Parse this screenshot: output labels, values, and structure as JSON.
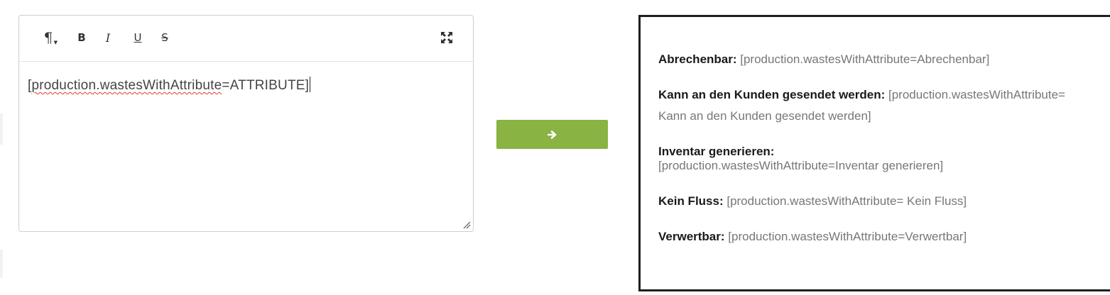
{
  "editor": {
    "toolbar": {
      "paragraph_icon": "¶",
      "bold_label": "B",
      "italic_label": "I",
      "underline_label": "U",
      "strike_label": "S",
      "fullscreen_icon": "expand-icon"
    },
    "content": {
      "open_bracket": "[",
      "spellcheck_word": "production.wastesWithAttribute",
      "rest": "=ATTRIBUTE]"
    }
  },
  "convert_button": {
    "icon": "arrow-right-icon",
    "color": "#89b342"
  },
  "preview": {
    "lines": [
      {
        "label": "Abrechenbar:",
        "value": " [production.wastesWithAttribute=Abrechenbar]"
      },
      {
        "label": "Kann an den Kunden gesendet werden:",
        "value": " [production.wastesWithAttribute=",
        "value_cont": "Kann an den Kunden gesendet werden]"
      },
      {
        "label": "Inventar generieren:",
        "value_cont": "[production.wastesWithAttribute=Inventar generieren]"
      },
      {
        "label": "Kein Fluss:",
        "value": " [production.wastesWithAttribute= Kein Fluss]"
      },
      {
        "label": "Verwertbar:",
        "value": " [production.wastesWithAttribute=Verwertbar]"
      }
    ]
  }
}
